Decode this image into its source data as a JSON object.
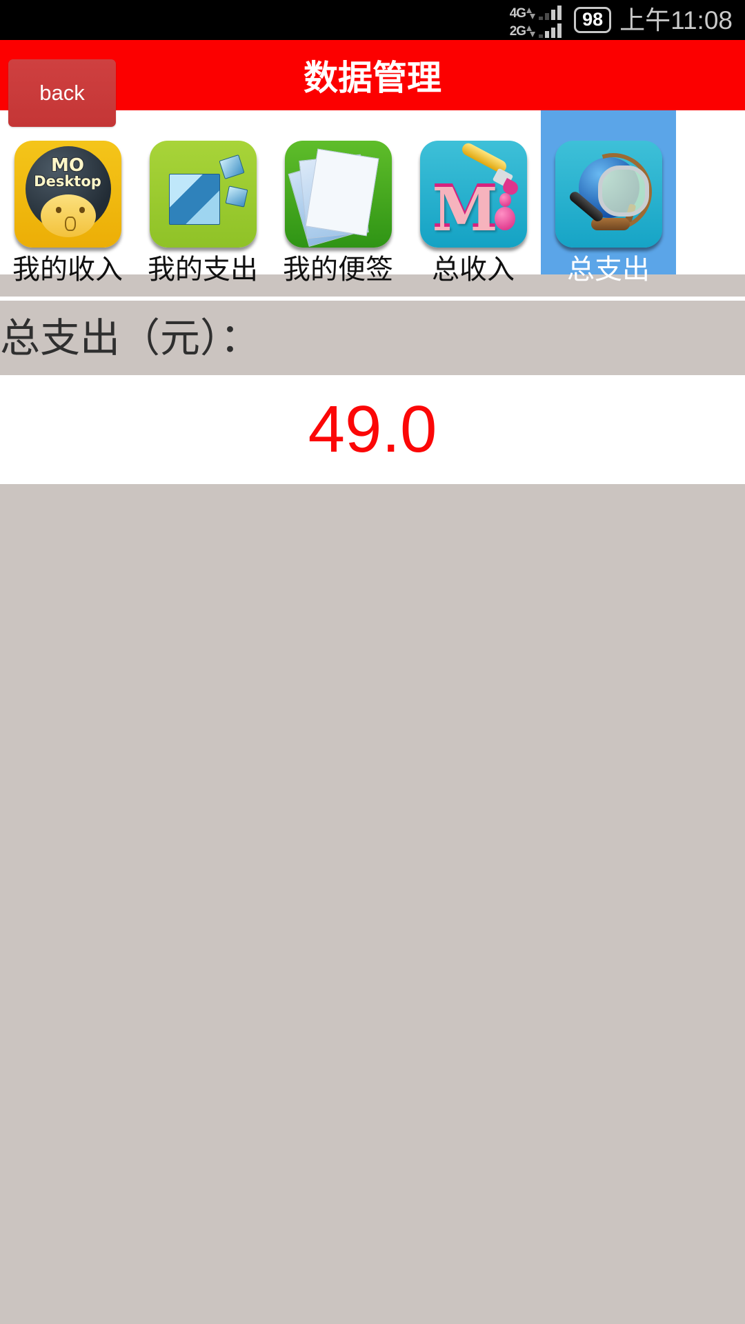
{
  "statusbar": {
    "network_primary": "4G",
    "network_secondary": "2G",
    "battery_level": "98",
    "time": "上午11:08"
  },
  "appbar": {
    "back_label": "back",
    "title": "数据管理",
    "background_color": "#fc0000"
  },
  "tabs": {
    "selected_index": 4,
    "selected_color": "#5ba5e8",
    "items": [
      {
        "label": "我的收入",
        "icon": "mo-desktop-icon"
      },
      {
        "label": "我的支出",
        "icon": "blue-cubes-icon"
      },
      {
        "label": "我的便签",
        "icon": "documents-icon"
      },
      {
        "label": "总收入",
        "icon": "paint-m-icon"
      },
      {
        "label": "总支出",
        "icon": "globe-magnifier-icon"
      }
    ]
  },
  "content": {
    "header": "总支出（元）：",
    "value": "49.0",
    "value_color": "#fb0707",
    "band_color": "#cbc4c0"
  }
}
